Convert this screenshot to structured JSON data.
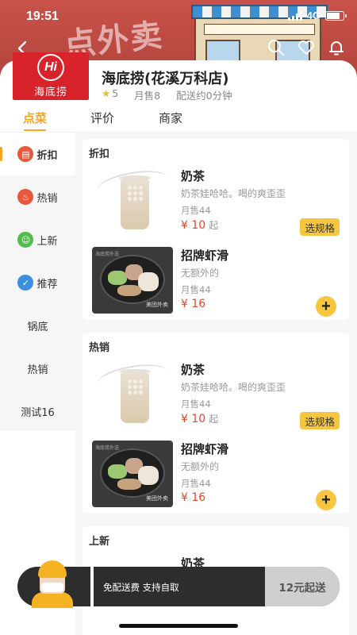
{
  "status_bar": {
    "time": "19:51",
    "network": "4G"
  },
  "banner": {
    "deco_text": "点外卖"
  },
  "store": {
    "logo_text": "海底捞",
    "logo_mark": "Hi",
    "name": "海底捞(花溪万科店)",
    "rating": "5",
    "monthly_sales": "月售8",
    "delivery_time": "配送约0分钟"
  },
  "tabs": [
    {
      "label": "点菜",
      "active": true
    },
    {
      "label": "评价",
      "active": false
    },
    {
      "label": "商家",
      "active": false
    }
  ],
  "categories": [
    {
      "label": "折扣",
      "icon": "discount-icon",
      "icon_char": "折",
      "color": "#e8563b",
      "active": true
    },
    {
      "label": "热销",
      "icon": "fire-icon",
      "icon_char": "♨",
      "color": "#e8563b",
      "active": false
    },
    {
      "label": "上新",
      "icon": "smile-icon",
      "icon_char": "☺",
      "color": "#4fbf4c",
      "active": false
    },
    {
      "label": "推荐",
      "icon": "thumb-up-icon",
      "icon_char": "👍",
      "color": "#3d8fe0",
      "active": false
    },
    {
      "label": "锅底",
      "active": false
    },
    {
      "label": "热销",
      "active": false
    },
    {
      "label": "测试16",
      "active": false
    }
  ],
  "sections": [
    {
      "title": "折扣",
      "dishes": [
        {
          "name": "奶茶",
          "desc": "奶茶娃哈哈。喝的爽歪歪",
          "sold": "月售44",
          "price": "¥ 10",
          "price_suffix": "起",
          "action": "选规格"
        },
        {
          "name": "招牌虾滑",
          "desc": "无额外的",
          "sold": "月售44",
          "price": "¥ 16",
          "action": "+"
        }
      ]
    },
    {
      "title": "热销",
      "dishes": [
        {
          "name": "奶茶",
          "desc": "奶茶娃哈哈。喝的爽歪歪",
          "sold": "月售44",
          "price": "¥ 10",
          "price_suffix": "起",
          "action": "选规格"
        },
        {
          "name": "招牌虾滑",
          "desc": "无额外的",
          "sold": "月售44",
          "price": "¥ 16",
          "action": "+"
        }
      ]
    },
    {
      "title": "上新",
      "dishes": [
        {
          "name": "奶茶"
        }
      ]
    }
  ],
  "cart": {
    "info": "免配送费 支持自取",
    "min_order": "12元起送"
  },
  "colors": {
    "accent": "#f5a623",
    "price": "#e5452c",
    "button": "#f7c640",
    "brand": "#d8232a"
  }
}
